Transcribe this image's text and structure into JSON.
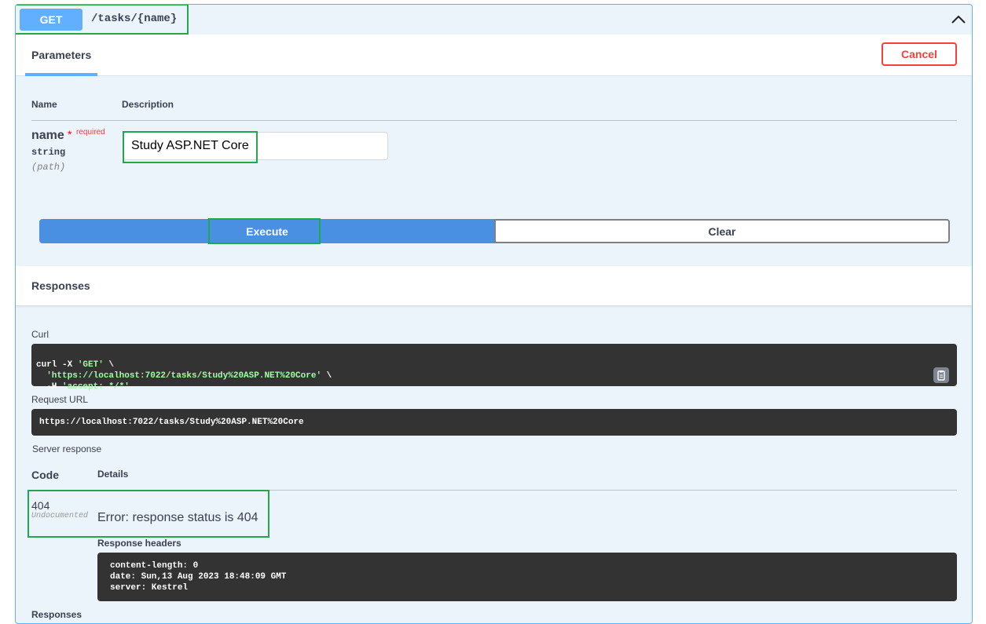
{
  "operation": {
    "method": "GET",
    "path": "/tasks/{name}"
  },
  "tabs": {
    "parameters_label": "Parameters",
    "cancel_label": "Cancel"
  },
  "params_table": {
    "col_name": "Name",
    "col_description": "Description"
  },
  "parameter": {
    "name": "name",
    "required_star": "*",
    "required_label": "required",
    "type": "string",
    "location": "(path)",
    "value": "Study ASP.NET Core"
  },
  "actions": {
    "execute_label": "Execute",
    "clear_label": "Clear"
  },
  "responses": {
    "section_label": "Responses",
    "curl_label": "Curl",
    "curl_line1_cmd": "curl -X ",
    "curl_line1_method": "'GET'",
    "curl_line1_cont": " \\",
    "curl_line2_url": "'https://localhost:7022/tasks/Study%20ASP.NET%20Core'",
    "curl_line2_cont": " \\",
    "curl_line3_flag": "  -H ",
    "curl_line3_header": "'accept: */*'",
    "request_url_label": "Request URL",
    "request_url": "https://localhost:7022/tasks/Study%20ASP.NET%20Core",
    "server_response_label": "Server response",
    "code_col": "Code",
    "details_col": "Details",
    "status_code": "404",
    "status_note": "Undocumented",
    "error_text": "Error: response status is 404",
    "response_headers_label": "Response headers",
    "headers": [
      "content-length: 0",
      "date: Sun,13 Aug 2023 18:48:09 GMT",
      "server: Kestrel"
    ],
    "footer_label": "Responses"
  },
  "colors": {
    "get_accent": "#61affe",
    "execute_blue": "#4990e2",
    "cancel_red": "#f93e3e",
    "highlight_green": "#22a74a",
    "code_bg": "#333333"
  },
  "icons": {
    "collapse": "chevron-up-icon",
    "copy": "clipboard-icon"
  }
}
